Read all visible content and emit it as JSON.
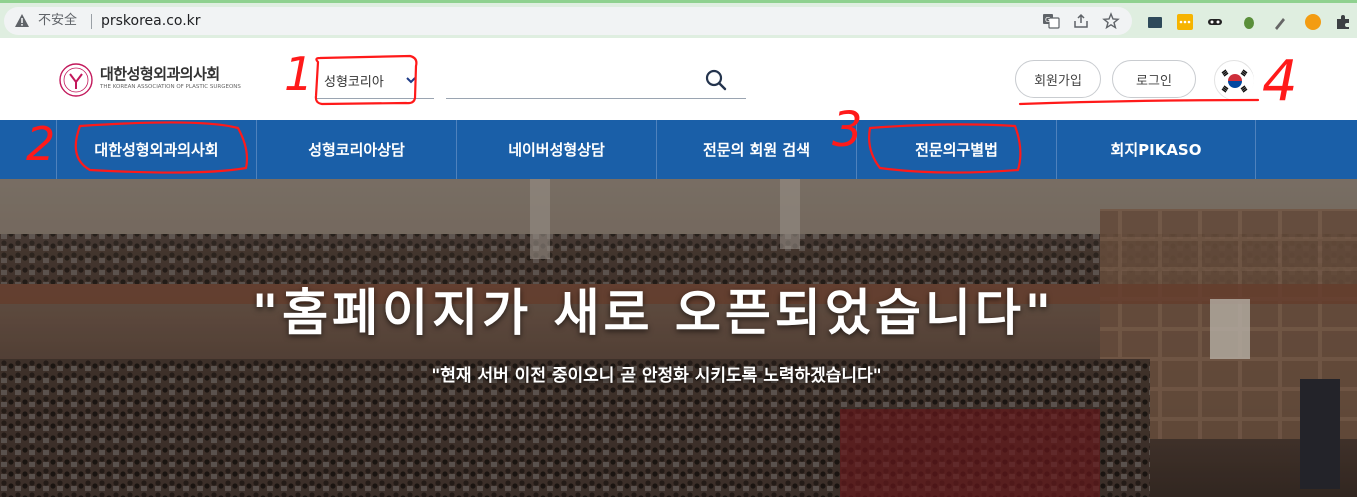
{
  "browser": {
    "insecure_label": "不安全",
    "url": "prskorea.co.kr"
  },
  "header": {
    "logo_title": "대한성형외과의사회",
    "logo_subtitle": "THE KOREAN ASSOCIATION OF PLASTIC SURGEONS",
    "search_select": "성형코리아",
    "search_placeholder": "",
    "signup_label": "회원가입",
    "login_label": "로그인"
  },
  "nav": {
    "items": [
      {
        "label": "대한성형외과의사회"
      },
      {
        "label": "성형코리아상담"
      },
      {
        "label": "네이버성형상담"
      },
      {
        "label": "전문의 회원 검색"
      },
      {
        "label": "전문의구별법"
      },
      {
        "label": "회지PIKASO"
      }
    ]
  },
  "hero": {
    "title": "\"홈페이지가 새로 오픈되었습니다\"",
    "subtitle": "\"현재 서버 이전 중이오니 곧 안정화 시키도록 노력하겠습니다\""
  },
  "annotations": {
    "labels": [
      "1",
      "2",
      "3",
      "4"
    ],
    "color": "#ff1a1a"
  },
  "colors": {
    "nav_bg": "#1a5fa8",
    "accent_logo": "#c2185b"
  },
  "icons": {
    "warning": "warning-icon",
    "translate": "translate-icon",
    "share": "share-icon",
    "star": "star-icon",
    "search": "search-icon",
    "chevron": "chevron-down-icon",
    "puzzle": "puzzle-icon"
  }
}
